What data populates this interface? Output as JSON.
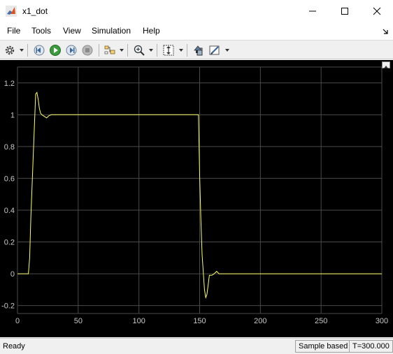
{
  "window": {
    "title": "x1_dot",
    "minimize_label": "Minimize",
    "maximize_label": "Maximize",
    "close_label": "Close"
  },
  "menu": {
    "items": [
      "File",
      "Tools",
      "View",
      "Simulation",
      "Help"
    ]
  },
  "toolbar": {
    "buttons": [
      "gear-icon",
      "step-back-icon",
      "run-icon",
      "step-forward-icon",
      "stop-icon",
      "highlight-icon",
      "zoom-icon",
      "autoscale-icon",
      "parameters-icon",
      "style-icon"
    ]
  },
  "status": {
    "ready": "Ready",
    "mode": "Sample based",
    "time": "T=300.000"
  },
  "colors": {
    "background": "#000000",
    "grid": "#4a4a4a",
    "axis_text": "#c8c8c8",
    "trace": "#ffff66"
  },
  "chart_data": {
    "type": "line",
    "title": "",
    "xlabel": "",
    "ylabel": "",
    "xlim": [
      0,
      300
    ],
    "ylim": [
      -0.25,
      1.3
    ],
    "xticks": [
      0,
      50,
      100,
      150,
      200,
      250,
      300
    ],
    "yticks": [
      -0.2,
      0,
      0.2,
      0.4,
      0.6,
      0.8,
      1,
      1.2
    ],
    "xtick_labels": [
      "0",
      "50",
      "100",
      "150",
      "200",
      "250",
      "300"
    ],
    "ytick_labels": [
      "-0.2",
      "0",
      "0.2",
      "0.4",
      "0.6",
      "0.8",
      "1",
      "1.2"
    ],
    "grid": true,
    "series": [
      {
        "color": "#ffff66",
        "x": [
          0,
          9,
          10,
          11,
          13,
          15,
          16,
          17,
          18,
          19,
          20,
          22,
          24,
          26,
          28,
          30,
          40,
          60,
          100,
          140,
          149,
          150,
          151,
          152,
          154,
          155,
          156,
          157,
          158,
          160,
          162,
          164,
          166,
          168,
          170,
          200,
          250,
          300
        ],
        "y": [
          0,
          0,
          0.1,
          0.35,
          0.75,
          1.13,
          1.14,
          1.1,
          1.04,
          1.01,
          1.0,
          0.99,
          0.98,
          0.995,
          1.0,
          1.0,
          1.0,
          1.0,
          1.0,
          1.0,
          1.0,
          0.62,
          0.35,
          0.12,
          -0.1,
          -0.15,
          -0.13,
          -0.07,
          -0.01,
          -0.01,
          0.0,
          0.015,
          0.0,
          0.0,
          0.0,
          0.0,
          0.0,
          0.0
        ]
      }
    ]
  }
}
